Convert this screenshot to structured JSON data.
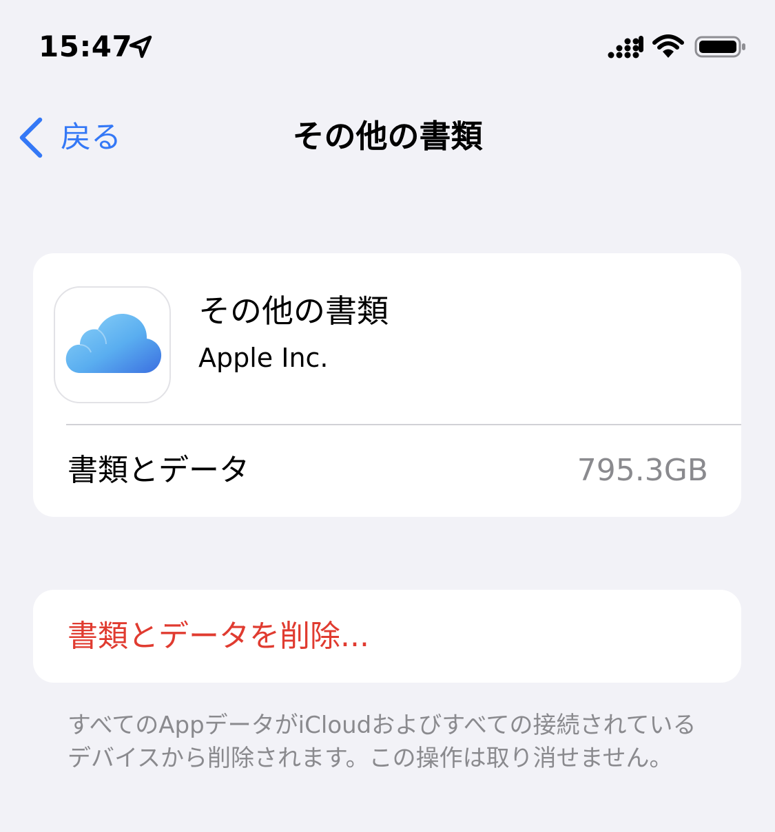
{
  "status_bar": {
    "time": "15:47",
    "icons": [
      "location-arrow-icon",
      "cellular-signal-icon",
      "wifi-icon",
      "battery-icon"
    ]
  },
  "nav": {
    "back_label": "戻る",
    "title": "その他の書類"
  },
  "app_info": {
    "name": "その他の書類",
    "developer": "Apple Inc.",
    "icon": "icloud-icon"
  },
  "storage_row": {
    "label": "書類とデータ",
    "value": "795.3GB"
  },
  "delete_action": {
    "label": "書類とデータを削除..."
  },
  "footnote": "すべてのAppデータがiCloudおよびすべての接続されているデバイスから削除されます。この操作は取り消せません。",
  "colors": {
    "background": "#f2f2f7",
    "card": "#ffffff",
    "accent": "#3478f6",
    "destructive": "#e03b30",
    "secondary_text": "#8a8a8e"
  }
}
